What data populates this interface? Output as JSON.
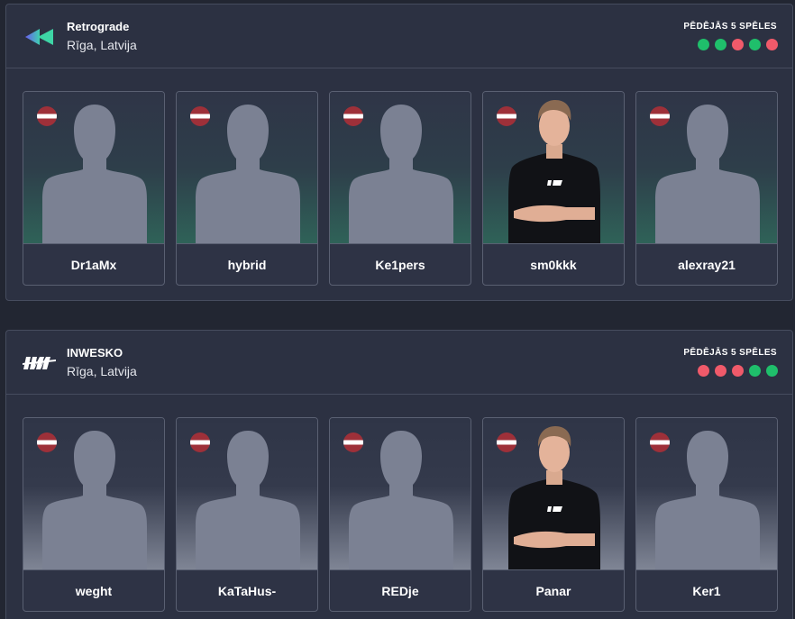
{
  "colors": {
    "win": "#1fbf6b",
    "loss": "#f05a6a",
    "flag_red": "#9e3039",
    "flag_white": "#ffffff",
    "silhouette": "#7b8193"
  },
  "teams": [
    {
      "name": "Retrograde",
      "location": "Rīga, Latvija",
      "logo_icon": "retrograde-logo-icon",
      "last5_label": "PĒDĒJĀS 5 SPĒLES",
      "last5": [
        "win",
        "win",
        "loss",
        "win",
        "loss"
      ],
      "players": [
        {
          "name": "Dr1aMx",
          "photo": "silhouette",
          "flag": "latvia-flag-icon"
        },
        {
          "name": "hybrid",
          "photo": "silhouette",
          "flag": "latvia-flag-icon"
        },
        {
          "name": "Ke1pers",
          "photo": "silhouette",
          "flag": "latvia-flag-icon"
        },
        {
          "name": "sm0kkk",
          "photo": "portrait",
          "flag": "latvia-flag-icon"
        },
        {
          "name": "alexray21",
          "photo": "silhouette",
          "flag": "latvia-flag-icon"
        }
      ]
    },
    {
      "name": "INWESKO",
      "location": "Rīga, Latvija",
      "logo_icon": "inwesko-logo-icon",
      "last5_label": "PĒDĒJĀS 5 SPĒLES",
      "last5": [
        "loss",
        "loss",
        "loss",
        "win",
        "win"
      ],
      "players": [
        {
          "name": "weght",
          "photo": "silhouette",
          "flag": "latvia-flag-icon"
        },
        {
          "name": "KaTaHus-",
          "photo": "silhouette",
          "flag": "latvia-flag-icon"
        },
        {
          "name": "REDje",
          "photo": "silhouette",
          "flag": "latvia-flag-icon"
        },
        {
          "name": "Panar",
          "photo": "portrait",
          "flag": "latvia-flag-icon"
        },
        {
          "name": "Ker1",
          "photo": "silhouette",
          "flag": "latvia-flag-icon"
        }
      ]
    }
  ]
}
